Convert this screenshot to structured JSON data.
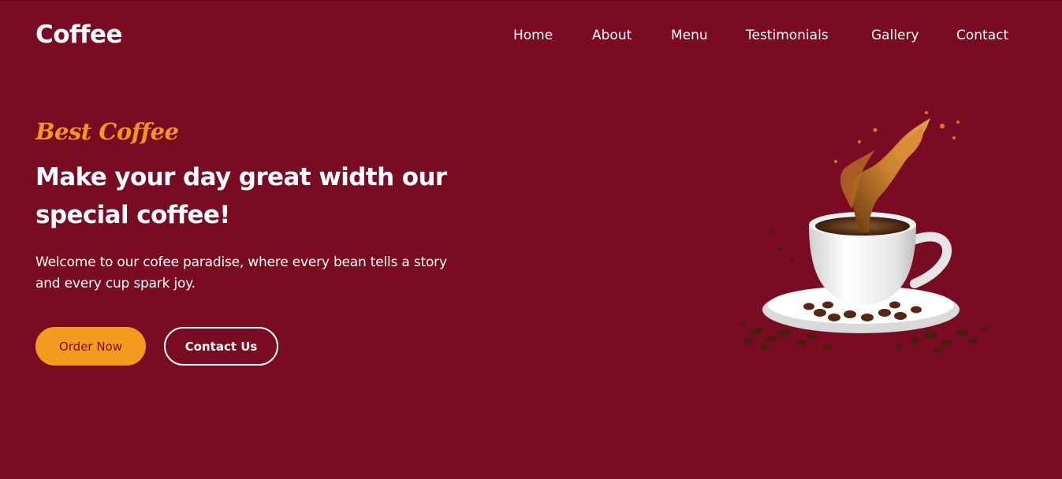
{
  "header": {
    "logo": "Coffee",
    "nav": [
      {
        "label": "Home"
      },
      {
        "label": "About"
      },
      {
        "label": "Menu"
      },
      {
        "label": "Testimonials"
      },
      {
        "label": "Gallery"
      },
      {
        "label": "Contact"
      }
    ]
  },
  "hero": {
    "eyebrow": "Best Coffee",
    "headline": "Make your day great width our special coffee!",
    "description": "Welcome to our cofee paradise, where every bean tells a story and every cup spark joy.",
    "order_button": "Order Now",
    "contact_button": "Contact Us"
  },
  "colors": {
    "background": "#790c22",
    "accent": "#f59a1c",
    "text": "#ffffff"
  },
  "image": {
    "subject": "coffee-cup-splash"
  }
}
